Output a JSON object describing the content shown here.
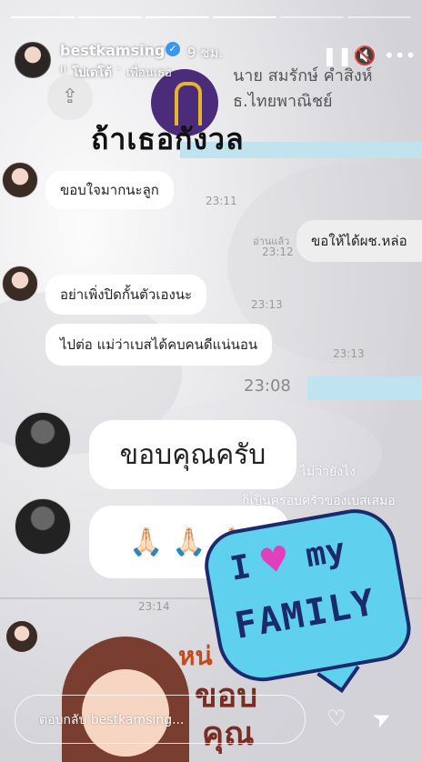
{
  "story": {
    "progress_segments": [
      1,
      1,
      1,
      1,
      0,
      0
    ],
    "username": "bestkamsing",
    "time_ago": "9 ชม.",
    "music_icon": "music-bars-icon",
    "music_title": "โปเตโต้",
    "music_song": "เพื่อนเธอ",
    "caption": "ถ้าเธอกังวล"
  },
  "header_buttons": {
    "pause": "pause-icon",
    "mute": "speaker-muted-icon",
    "more": "more-icon"
  },
  "background": {
    "bank_name_line1": "นาย สมรักษ์ คำสิงห์",
    "bank_name_line2": "ธ.ไทยพาณิชย์"
  },
  "chat": {
    "m1": "ขอบใจมากนะลูก",
    "t1": "23:11",
    "read_label": "อ่านแล้ว",
    "t2": "23:12",
    "r1": "ขอให้ได้ผช.หล่อ",
    "m2": "อย่าเพิ่งปิดกั้นตัวเองนะ",
    "t3": "23:13",
    "m3": "ไปต่อ แม่ว่าเบสได้คบคนดีแน่นอน",
    "t4": "23:13",
    "t5": "23:08",
    "big1": "ขอบคุณครับ",
    "emoji": "🙏🏻 🙏🏻 🙏🏻",
    "overlay1": "ไม่ว่ายังไง",
    "overlay2": "ก็เป็นครอบครัวของเบสเสมอ",
    "t6": "23:14"
  },
  "sticker": {
    "line1_a": "I",
    "line1_b": "my",
    "line2": "FAMILY",
    "heart": "♥"
  },
  "thai_sticker": {
    "line1": "หน่",
    "line2": "ขอบ",
    "line3": "คุณ"
  },
  "footer": {
    "reply_placeholder": "ตอบกลับ bestkamsing...",
    "like_icon": "♡",
    "send_icon": "➤"
  },
  "colors": {
    "verified": "#3897f0",
    "sticker_blue": "#5fd0ee",
    "heart": "#e23fbf"
  }
}
